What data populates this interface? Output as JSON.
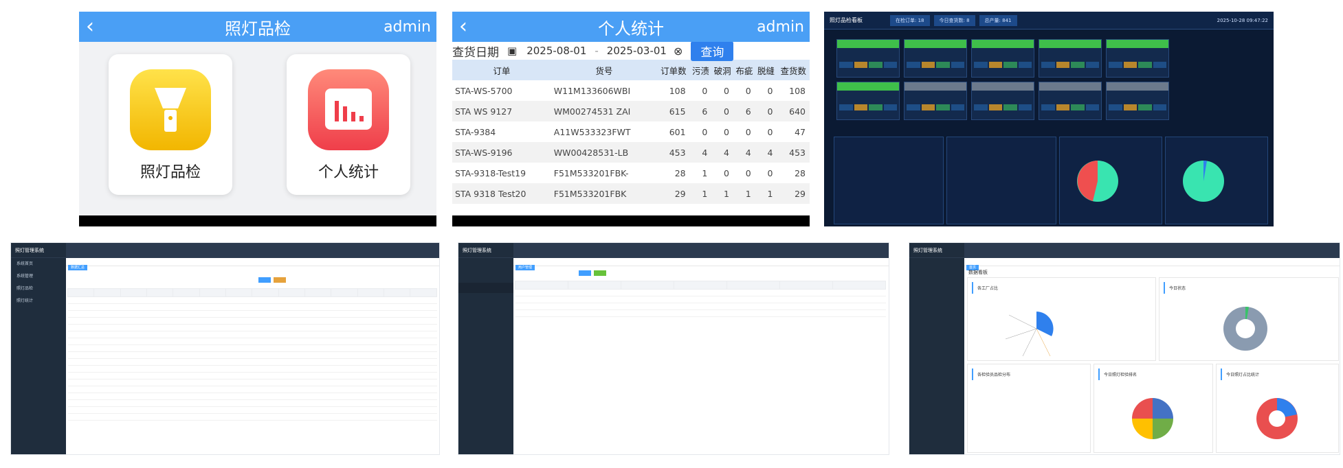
{
  "p1": {
    "back": "‹",
    "title": "照灯品检",
    "user": "admin",
    "cards": [
      {
        "label": "照灯品检",
        "color": "#f5c518",
        "icon": "flashlight-icon"
      },
      {
        "label": "个人统计",
        "color": "#f25a5a",
        "icon": "bar-chart-icon"
      }
    ]
  },
  "p2": {
    "back": "‹",
    "title": "个人统计",
    "user": "admin",
    "date_label": "查货日期",
    "date_from": "2025-08-01",
    "date_sep": "-",
    "date_to": "2025-03-01",
    "query_label": "查询",
    "columns": [
      "订单",
      "货号",
      "订单数",
      "污渍",
      "破洞",
      "布疵",
      "脱缝",
      "查货数"
    ],
    "rows": [
      [
        "STA-WS-5700",
        "W11M133606WBI",
        "108",
        "0",
        "0",
        "0",
        "0",
        "108"
      ],
      [
        "STA WS 9127",
        "WM00274531 ZAI",
        "615",
        "6",
        "0",
        "6",
        "0",
        "640"
      ],
      [
        "STA-9384",
        "A11W533323FWT",
        "601",
        "0",
        "0",
        "0",
        "0",
        "47"
      ],
      [
        "STA-WS-9196",
        "WW00428531-LB",
        "453",
        "4",
        "4",
        "4",
        "4",
        "453"
      ],
      [
        "STA-9318-Test19",
        "F51M533201FBK-",
        "28",
        "1",
        "0",
        "0",
        "0",
        "28"
      ],
      [
        "STA 9318 Test20",
        "F51M533201FBK",
        "29",
        "1",
        "1",
        "1",
        "1",
        "29"
      ]
    ]
  },
  "p3": {
    "title": "照灯品检看板",
    "tabs": [
      "在检订单: 18",
      "今日查货数: 8",
      "总产量: 841"
    ],
    "time": "2025-10-28 09:47:22"
  },
  "p4": {
    "logo": "照灯管理系统",
    "crumb": "数据汇总",
    "menu": [
      "系统首页",
      "系统管理",
      "照灯品检",
      "照灯统计"
    ]
  },
  "p5": {
    "logo": "照灯管理系统",
    "crumb": "用户管理"
  },
  "p6": {
    "logo": "照灯管理系统",
    "crumb": "首页",
    "section": "数据看板",
    "cards": [
      "各工厂占比",
      "今日状态",
      "各检验员品检分布",
      "今日照灯检验排名",
      "今日照灯占比统计"
    ]
  }
}
